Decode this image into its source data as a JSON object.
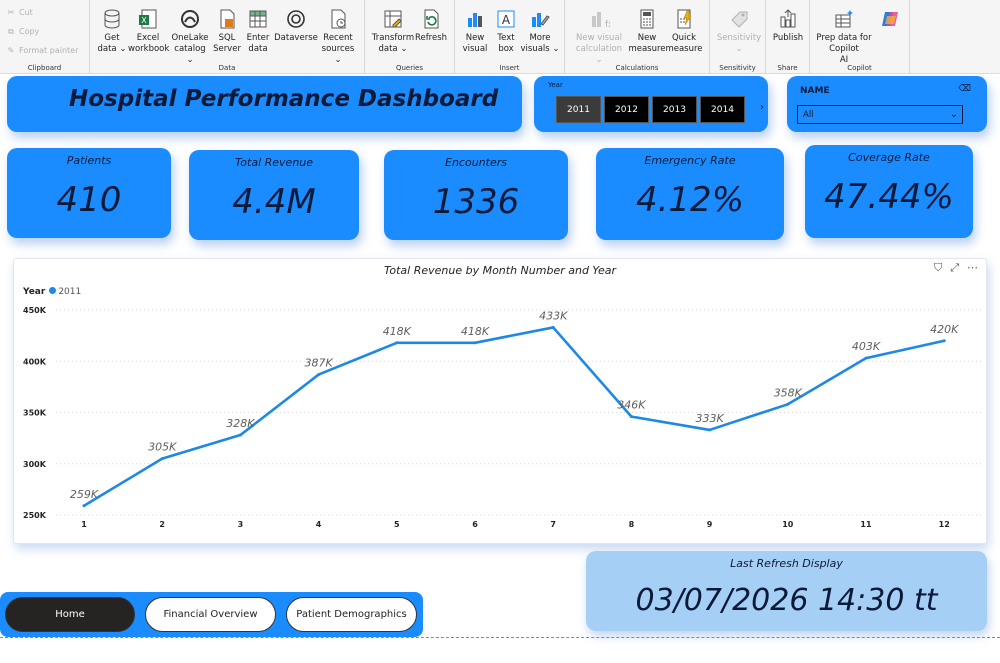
{
  "ribbon": {
    "clipboard": {
      "label": "Clipboard",
      "cut": "Cut",
      "copy": "Copy",
      "format_painter": "Format painter"
    },
    "data": {
      "label": "Data",
      "get_data": [
        "Get",
        "data ⌄"
      ],
      "excel": [
        "Excel",
        "workbook"
      ],
      "onelake": [
        "OneLake",
        "catalog ⌄"
      ],
      "sql": [
        "SQL",
        "Server"
      ],
      "enter": [
        "Enter",
        "data"
      ],
      "dataverse": [
        "Dataverse",
        ""
      ],
      "recent": [
        "Recent",
        "sources ⌄"
      ]
    },
    "queries": {
      "label": "Queries",
      "transform": [
        "Transform",
        "data ⌄"
      ],
      "refresh": [
        "Refresh",
        ""
      ]
    },
    "insert": {
      "label": "Insert",
      "new_visual": [
        "New",
        "visual"
      ],
      "text_box": [
        "Text",
        "box"
      ],
      "more_visuals": [
        "More",
        "visuals ⌄"
      ]
    },
    "calculations": {
      "label": "Calculations",
      "new_visual_calc": [
        "New visual",
        "calculation ⌄"
      ],
      "new_measure": [
        "New",
        "measure"
      ],
      "quick_measure": [
        "Quick",
        "measure"
      ]
    },
    "sensitivity": {
      "label": "Sensitivity",
      "sensitivity": [
        "Sensitivity",
        "⌄"
      ]
    },
    "share": {
      "label": "Share",
      "publish": [
        "Publish",
        ""
      ]
    },
    "copilot": {
      "label": "Copilot",
      "prep": [
        "Prep data for Copilot",
        "AI"
      ]
    }
  },
  "dashboard": {
    "title": "Hospital Performance Dashboard",
    "year_slicer": {
      "label": "Year",
      "options": [
        "2011",
        "2012",
        "2013",
        "2014"
      ],
      "selected": "2011"
    },
    "name_slicer": {
      "label": "NAME",
      "value": "All"
    },
    "kpis": {
      "patients": {
        "label": "Patients",
        "value": "410"
      },
      "revenue": {
        "label": "Total Revenue",
        "value": "4.4M"
      },
      "encounters": {
        "label": "Encounters",
        "value": "1336"
      },
      "emergency": {
        "label": "Emergency Rate",
        "value": "4.12%"
      },
      "coverage": {
        "label": "Coverage Rate",
        "value": "47.44%"
      }
    },
    "refresh": {
      "label": "Last Refresh Display",
      "value": "03/07/2026 14:30 tt"
    },
    "nav": {
      "home": "Home",
      "financial": "Financial Overview",
      "demographics": "Patient Demographics"
    }
  },
  "colors": {
    "accent": "#1a8cff",
    "line": "#1e88e5",
    "dark_text": "#0b1a38",
    "refresh_bg": "#a6cff5"
  },
  "chart_data": {
    "type": "line",
    "title": "Total Revenue by Month Number and Year",
    "legend_title": "Year",
    "legend_position": "top-left",
    "categories": [
      1,
      2,
      3,
      4,
      5,
      6,
      7,
      8,
      9,
      10,
      11,
      12
    ],
    "series": [
      {
        "name": "2011",
        "values": [
          259000,
          305000,
          328000,
          387000,
          418000,
          418000,
          433000,
          346000,
          333000,
          358000,
          403000,
          420000
        ],
        "labels": [
          "259K",
          "305K",
          "328K",
          "387K",
          "418K",
          "418K",
          "433K",
          "346K",
          "333K",
          "358K",
          "403K",
          "420K"
        ]
      }
    ],
    "y_ticks": [
      250000,
      300000,
      350000,
      400000,
      450000
    ],
    "y_tick_labels": [
      "250K",
      "300K",
      "350K",
      "400K",
      "450K"
    ],
    "ylim": [
      250000,
      450000
    ],
    "grid": true
  }
}
